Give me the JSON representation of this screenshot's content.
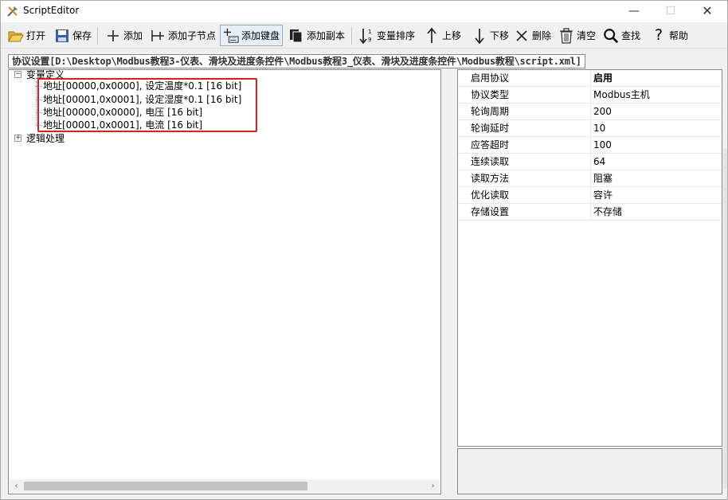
{
  "window": {
    "title": "ScriptEditor",
    "controls": {
      "minimize": "—",
      "maximize": "☐",
      "close": "✕"
    }
  },
  "toolbar": {
    "items": [
      {
        "label": "打开",
        "icon": "folder-open-icon"
      },
      {
        "label": "保存",
        "icon": "save-icon"
      },
      {
        "label": "添加",
        "icon": "plus-icon"
      },
      {
        "label": "添加子节点",
        "icon": "add-child-icon"
      },
      {
        "label": "添加键盘",
        "icon": "add-keyboard-icon"
      },
      {
        "label": "添加副本",
        "icon": "copy-icon"
      },
      {
        "label": "变量排序",
        "icon": "sort-icon"
      },
      {
        "label": "上移",
        "icon": "arrow-up-icon"
      },
      {
        "label": "下移",
        "icon": "arrow-down-icon"
      },
      {
        "label": "删除",
        "icon": "delete-x-icon"
      },
      {
        "label": "清空",
        "icon": "trash-icon"
      },
      {
        "label": "查找",
        "icon": "search-icon"
      },
      {
        "label": "帮助",
        "icon": "help-icon"
      }
    ]
  },
  "path": "协议设置[D:\\Desktop\\Modbus教程3-仪表、滑块及进度条控件\\Modbus教程3_仪表、滑块及进度条控件\\Modbus教程\\script.xml]",
  "tree": {
    "variables_label": "变量定义",
    "variables_expander": "−",
    "variables": [
      "地址[00000,0x0000], 设定温度*0.1 [16 bit]",
      "地址[00001,0x0001], 设定湿度*0.1 [16 bit]",
      "地址[00000,0x0000], 电压 [16 bit]",
      "地址[00001,0x0001], 电流 [16 bit]"
    ],
    "logic_label": "逻辑处理",
    "logic_expander": "+",
    "scroll": {
      "left": "‹",
      "right": "›"
    }
  },
  "properties": [
    {
      "name": "启用协议",
      "value": "启用",
      "bold": true
    },
    {
      "name": "协议类型",
      "value": "Modbus主机"
    },
    {
      "name": "轮询周期",
      "value": "200"
    },
    {
      "name": "轮询延时",
      "value": "10"
    },
    {
      "name": "应答超时",
      "value": "100"
    },
    {
      "name": "连续读取",
      "value": "64"
    },
    {
      "name": "读取方法",
      "value": "阻塞"
    },
    {
      "name": "优化读取",
      "value": "容许"
    },
    {
      "name": "存储设置",
      "value": "不存储"
    }
  ],
  "colors": {
    "highlight": "#d62020",
    "window_bg": "#f0f0f0"
  }
}
